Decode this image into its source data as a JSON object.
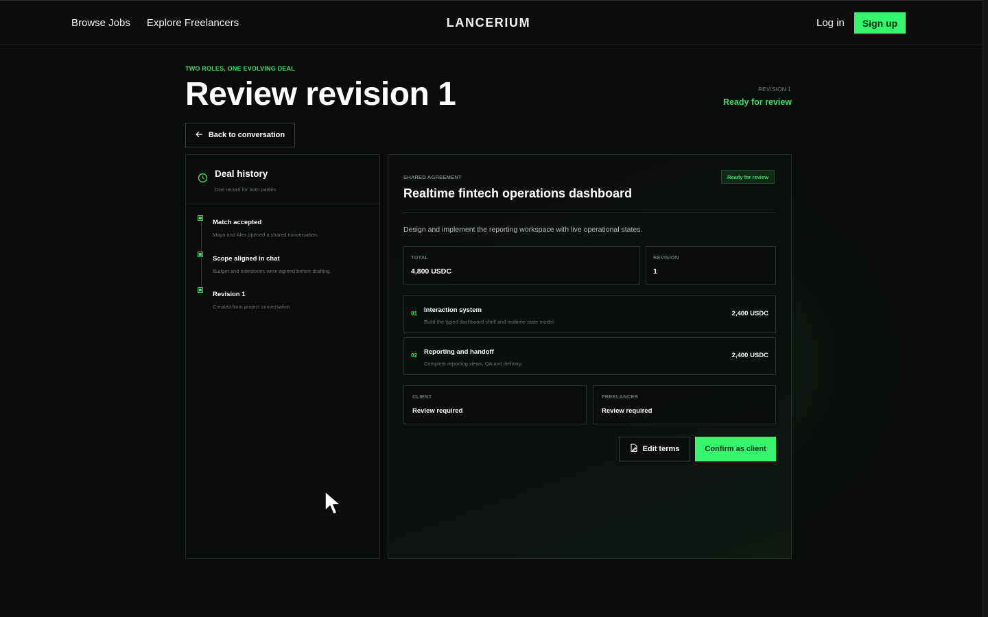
{
  "nav": {
    "links": [
      "Browse Jobs",
      "Explore Freelancers"
    ],
    "brand": "LANCERIUM",
    "login": "Log in",
    "signup": "Sign up"
  },
  "header": {
    "kicker": "TWO ROLES, ONE EVOLVING DEAL",
    "title": "Review revision 1",
    "revision_label": "REVISION 1",
    "revision_status": "Ready for review",
    "back_button": "Back to conversation"
  },
  "history": {
    "title": "Deal history",
    "subtitle": "One record for both parties",
    "items": [
      {
        "title": "Match accepted",
        "desc": "Maya and Alex opened a shared conversation."
      },
      {
        "title": "Scope aligned in chat",
        "desc": "Budget and milestones were agreed before drafting."
      },
      {
        "title": "Revision 1",
        "desc": "Created from project conversation"
      }
    ]
  },
  "agreement": {
    "label": "SHARED AGREEMENT",
    "badge": "Ready for review",
    "title": "Realtime fintech operations dashboard",
    "description": "Design and implement the reporting workspace with live operational states.",
    "total_label": "TOTAL",
    "total_value": "4,800 USDC",
    "revision_label": "REVISION",
    "revision_value": "1",
    "milestones": [
      {
        "num": "01",
        "title": "Interaction system",
        "desc": "Build the typed dashboard shell and realtime state model.",
        "amount": "2,400 USDC"
      },
      {
        "num": "02",
        "title": "Reporting and handoff",
        "desc": "Complete reporting views, QA and delivery.",
        "amount": "2,400 USDC"
      }
    ],
    "client_label": "CLIENT",
    "client_value": "Review required",
    "freelancer_label": "FREELANCER",
    "freelancer_value": "Review required",
    "edit_button": "Edit terms",
    "confirm_button": "Confirm as client"
  },
  "colors": {
    "accent": "#33f56e",
    "background": "#0a0b0b",
    "border": "#2a2e2c"
  },
  "icons": [
    "arrow-left-icon",
    "clock-icon",
    "edit-document-icon",
    "cursor-icon"
  ]
}
